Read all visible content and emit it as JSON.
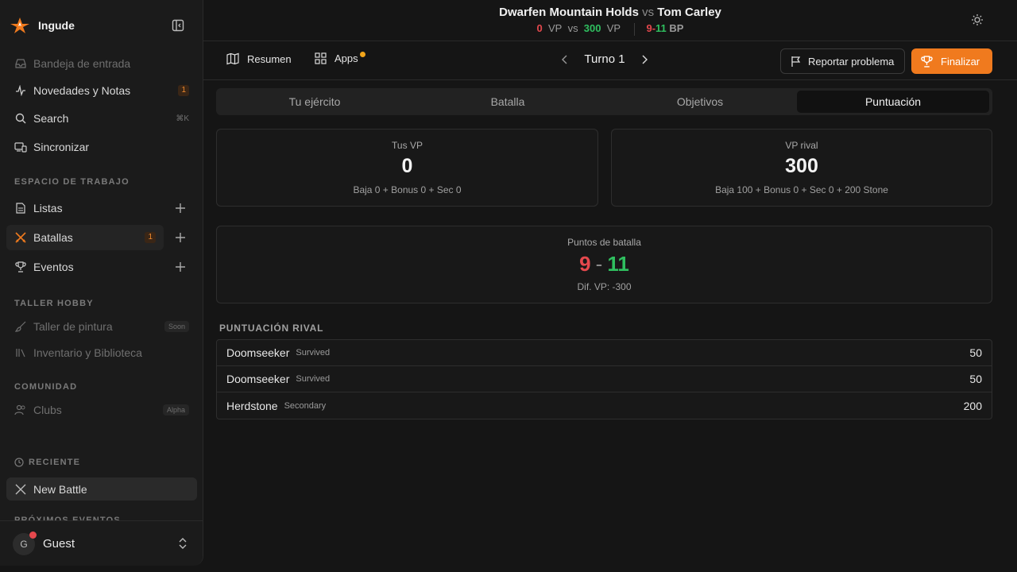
{
  "app": {
    "name": "Ingude"
  },
  "sidebar": {
    "nav": [
      {
        "label": "Bandeja de entrada"
      },
      {
        "label": "Novedades y Notas",
        "badge": "1"
      },
      {
        "label": "Search",
        "shortcut": "⌘K"
      },
      {
        "label": "Sincronizar"
      }
    ],
    "workspace_label": "ESPACIO DE TRABAJO",
    "workspace": [
      {
        "label": "Listas"
      },
      {
        "label": "Batallas",
        "badge": "1"
      },
      {
        "label": "Eventos"
      }
    ],
    "hobby_label": "TALLER HOBBY",
    "hobby": [
      {
        "label": "Taller de pintura",
        "tag": "Soon"
      },
      {
        "label": "Inventario y Biblioteca"
      }
    ],
    "community_label": "COMUNIDAD",
    "community": [
      {
        "label": "Clubs",
        "tag": "Alpha"
      }
    ],
    "recent_label": "RECIENTE",
    "recent": [
      {
        "label": "New Battle"
      }
    ],
    "upcoming_label": "PRÓXIMOS EVENTOS",
    "user": {
      "initial": "G",
      "name": "Guest"
    }
  },
  "header": {
    "player": "Dwarfen Mountain Holds",
    "vs": "vs",
    "opponent": "Tom Carley",
    "my_vp": "0",
    "vp_unit": "VP",
    "score_vs": "vs",
    "opp_vp": "300",
    "bp_mine": "9",
    "bp_dash": "-",
    "bp_opp": "11",
    "bp_unit": "BP"
  },
  "toolbar": {
    "summary": "Resumen",
    "apps": "Apps",
    "turn": "Turno 1",
    "report": "Reportar problema",
    "finish": "Finalizar"
  },
  "tabs": [
    {
      "label": "Tu ejército"
    },
    {
      "label": "Batalla"
    },
    {
      "label": "Objetivos"
    },
    {
      "label": "Puntuación",
      "active": true
    }
  ],
  "cards": {
    "my_vp": {
      "label": "Tus VP",
      "value": "0",
      "detail": "Baja 0 + Bonus 0 + Sec 0"
    },
    "rival_vp": {
      "label": "VP rival",
      "value": "300",
      "detail": "Baja 100 + Bonus 0 + Sec 0 + 200 Stone"
    },
    "battle_points": {
      "label": "Puntos de batalla",
      "mine": "9",
      "dash": "-",
      "opp": "11",
      "diff": "Dif. VP: -300"
    }
  },
  "rival_scoring": {
    "title": "PUNTUACIÓN RIVAL",
    "rows": [
      {
        "name": "Doomseeker",
        "type": "Survived",
        "points": "50"
      },
      {
        "name": "Doomseeker",
        "type": "Survived",
        "points": "50"
      },
      {
        "name": "Herdstone",
        "type": "Secondary",
        "points": "200"
      }
    ]
  },
  "colors": {
    "accent": "#f07a1e",
    "negative": "#e5484d",
    "positive": "#2fbf5f"
  }
}
